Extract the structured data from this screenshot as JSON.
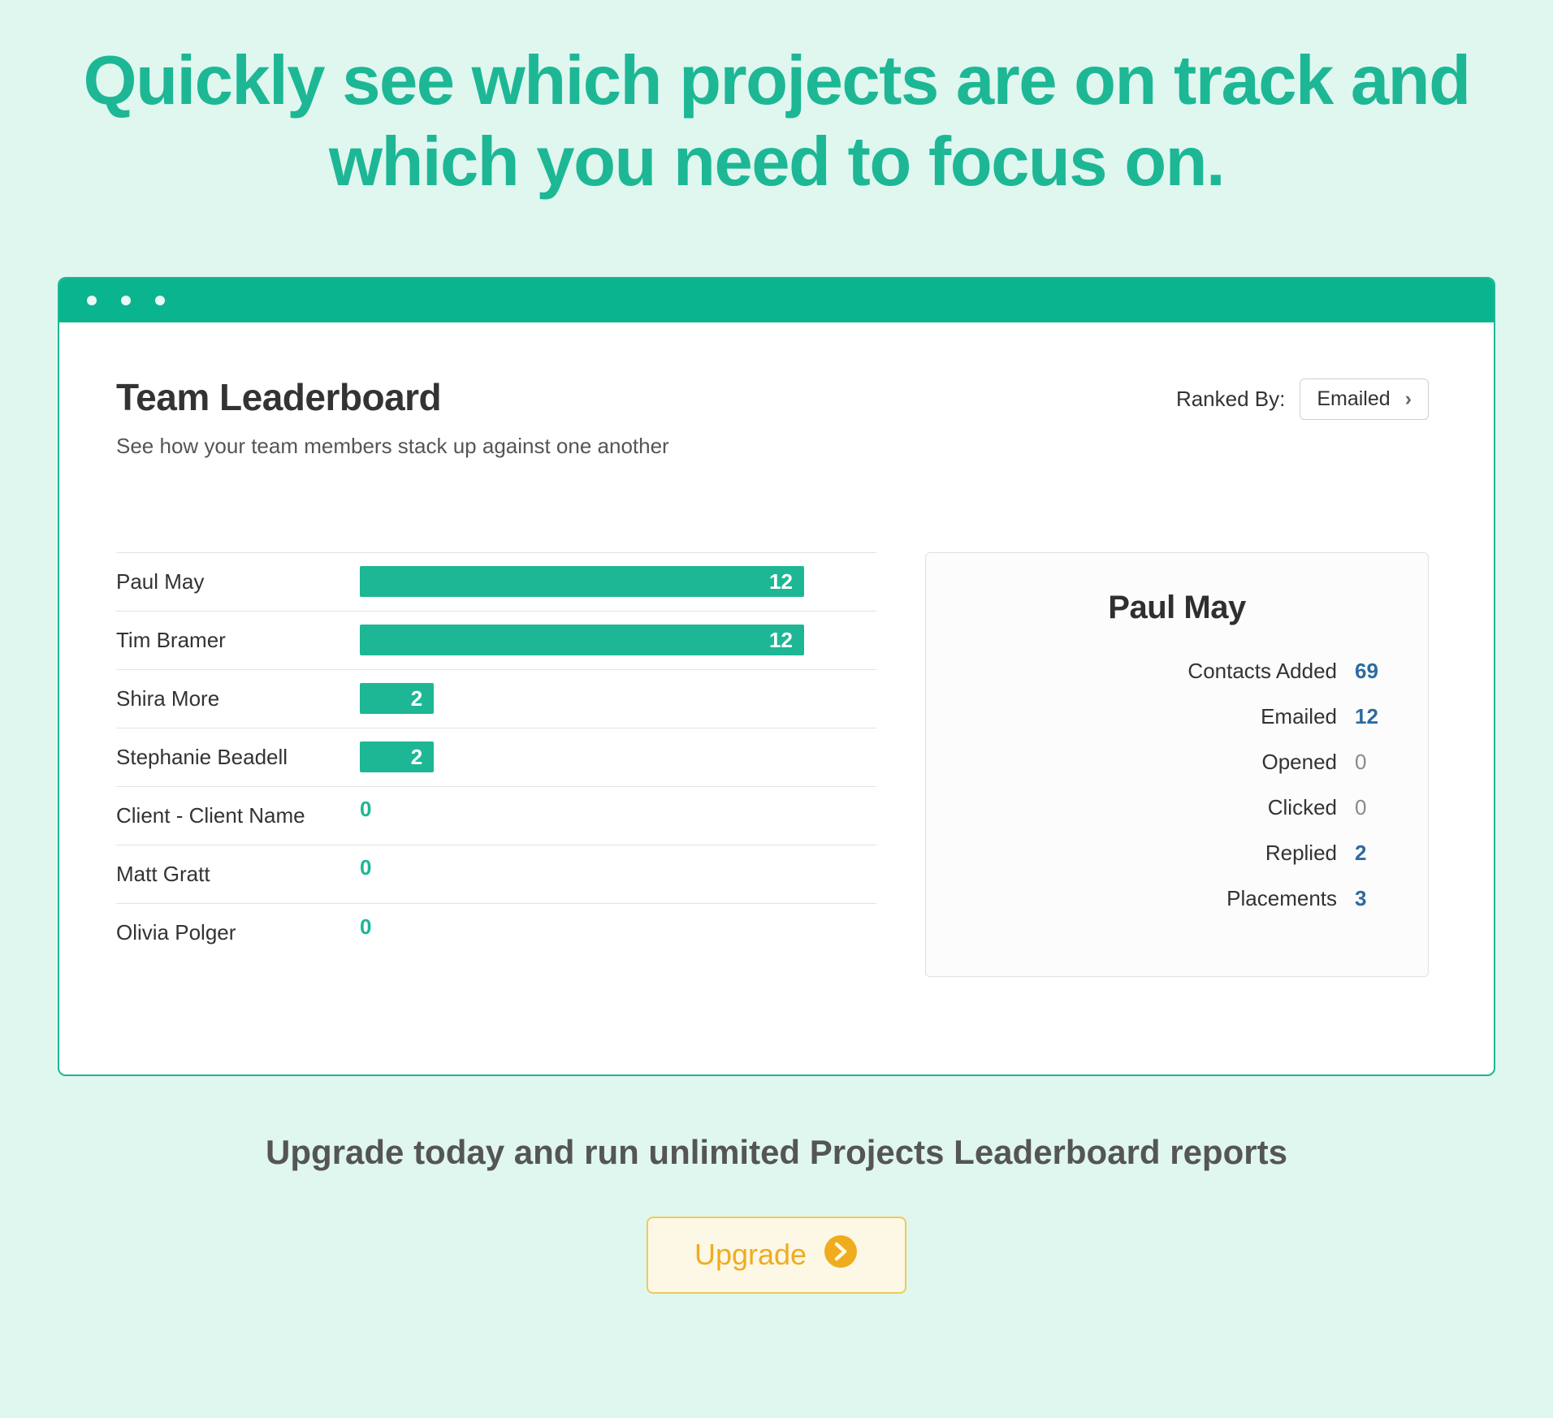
{
  "hero": "Quickly see which projects are on track and which you need to focus on.",
  "leaderboard": {
    "title": "Team Leaderboard",
    "subtitle": "See how your team members stack up against one another",
    "ranked_by_label": "Ranked By:",
    "ranked_by_value": "Emailed"
  },
  "detail": {
    "name": "Paul May",
    "stats": [
      {
        "label": "Contacts Added",
        "value": "69",
        "highlight": true
      },
      {
        "label": "Emailed",
        "value": "12",
        "highlight": true
      },
      {
        "label": "Opened",
        "value": "0",
        "highlight": false
      },
      {
        "label": "Clicked",
        "value": "0",
        "highlight": false
      },
      {
        "label": "Replied",
        "value": "2",
        "highlight": true
      },
      {
        "label": "Placements",
        "value": "3",
        "highlight": true
      }
    ]
  },
  "cta": {
    "text": "Upgrade today and run unlimited Projects Leaderboard reports",
    "button": "Upgrade"
  },
  "chart_data": {
    "type": "bar",
    "title": "Team Leaderboard",
    "xlabel": "Emailed",
    "ylabel": "",
    "xlim": [
      0,
      12
    ],
    "categories": [
      "Paul May",
      "Tim Bramer",
      "Shira More",
      "Stephanie Beadell",
      "Client - Client Name",
      "Matt Gratt",
      "Olivia Polger"
    ],
    "values": [
      12,
      12,
      2,
      2,
      0,
      0,
      0
    ]
  }
}
